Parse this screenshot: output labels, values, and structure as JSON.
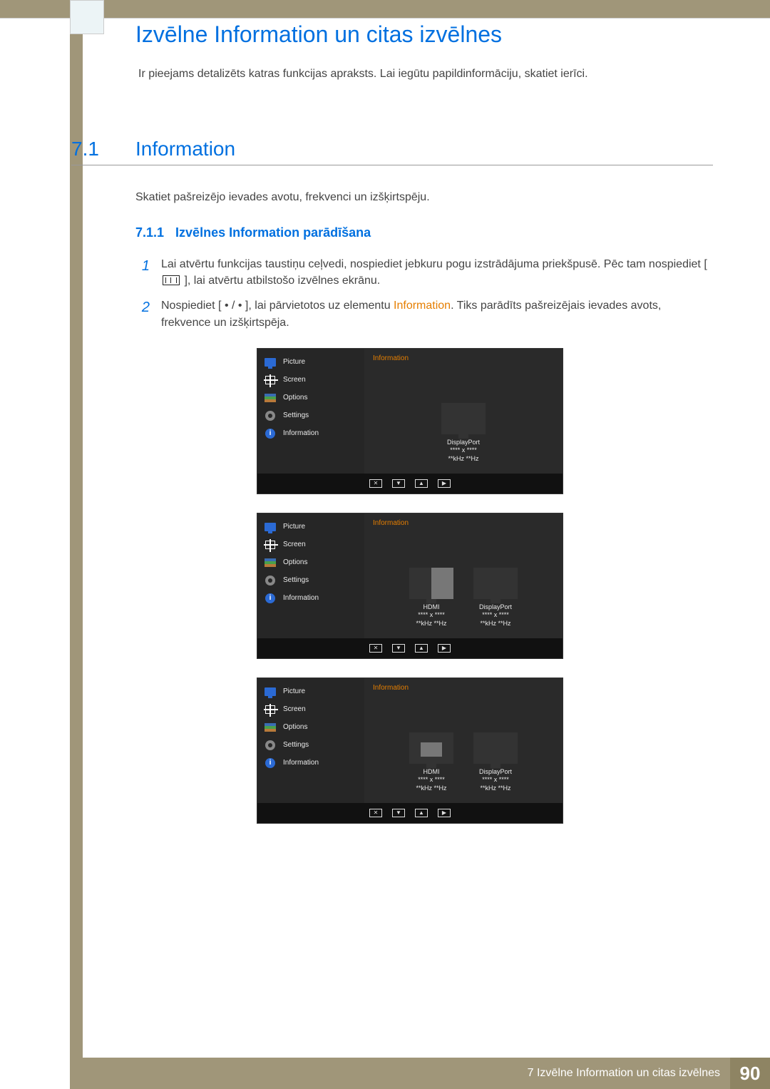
{
  "header": {
    "chapter_title": "Izvēlne Information un citas izvēlnes",
    "intro": "Ir pieejams detalizēts katras funkcijas apraksts. Lai iegūtu papildinformāciju, skatiet ierīci."
  },
  "section": {
    "num": "7.1",
    "title": "Information",
    "body": "Skatiet pašreizējo ievades avotu, frekvenci un izšķirtspēju."
  },
  "subsection": {
    "num": "7.1.1",
    "title": "Izvēlnes Information parādīšana"
  },
  "steps": [
    {
      "num": "1",
      "pre": "Lai atvērtu funkcijas taustiņu ceļvedi, nospiediet jebkuru pogu izstrādājuma priekšpusē. Pēc tam nospiediet [ ",
      "post": " ], lai atvērtu atbilstošo izvēlnes ekrānu."
    },
    {
      "num": "2",
      "pre": "Nospiediet [ • / • ], lai pārvietotos uz elementu ",
      "highlight": "Information",
      "post": ". Tiks parādīts pašreizējais ievades avots, frekvence un izšķirtspēja."
    }
  ],
  "osd": {
    "sidebar": [
      {
        "icon": "picture",
        "label": "Picture"
      },
      {
        "icon": "screen",
        "label": "Screen"
      },
      {
        "icon": "options",
        "label": "Options"
      },
      {
        "icon": "settings",
        "label": "Settings"
      },
      {
        "icon": "info",
        "label": "Information"
      }
    ],
    "heading": "Information",
    "nav": [
      "✕",
      "▼",
      "▲",
      "▶"
    ],
    "screens": [
      {
        "panels": [
          {
            "style": "plain",
            "name": "DisplayPort",
            "res": "**** x ****",
            "hz": "**kHz **Hz"
          }
        ]
      },
      {
        "panels": [
          {
            "style": "half",
            "name": "HDMI",
            "res": "**** x ****",
            "hz": "**kHz **Hz"
          },
          {
            "style": "plain",
            "name": "DisplayPort",
            "res": "**** x ****",
            "hz": "**kHz **Hz"
          }
        ]
      },
      {
        "panels": [
          {
            "style": "quarter",
            "name": "HDMI",
            "res": "**** x ****",
            "hz": "**kHz **Hz"
          },
          {
            "style": "plain",
            "name": "DisplayPort",
            "res": "**** x ****",
            "hz": "**kHz **Hz"
          }
        ]
      }
    ]
  },
  "footer": {
    "text": "7 Izvēlne Information un citas izvēlnes",
    "page": "90"
  }
}
